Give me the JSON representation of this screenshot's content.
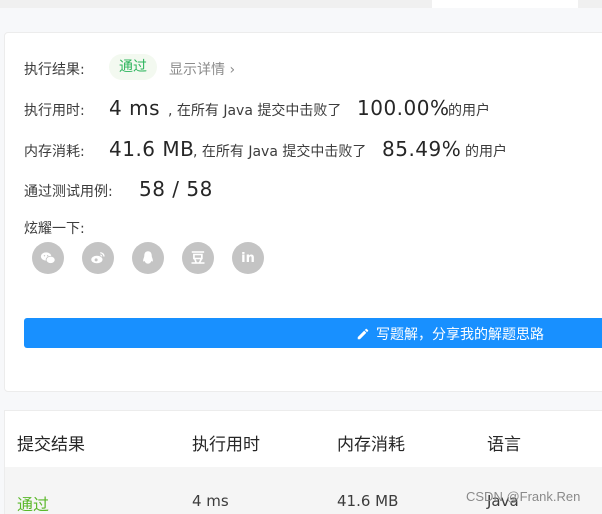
{
  "result": {
    "label": "执行结果:",
    "status": "通过",
    "details_link": "显示详情 ›"
  },
  "runtime": {
    "label": "执行用时:",
    "value": "4 ms",
    "mid_text": ", 在所有 Java 提交中击败了",
    "percent": "100.00%",
    "suffix": "的用户"
  },
  "memory": {
    "label": "内存消耗:",
    "value": "41.6 MB",
    "mid_text": ", 在所有 Java 提交中击败了",
    "percent": "85.49%",
    "suffix": "的用户"
  },
  "tests": {
    "label": "通过测试用例:",
    "value": "58 / 58"
  },
  "share": {
    "label": "炫耀一下:",
    "icons": [
      "wechat-icon",
      "weibo-icon",
      "qq-icon",
      "douban-icon",
      "linkedin-icon"
    ],
    "douban_glyph": "豆",
    "linkedin_glyph": "in"
  },
  "write_solution": {
    "label": "写题解，分享我的解题思路"
  },
  "submissions": {
    "headers": [
      "提交结果",
      "执行用时",
      "内存消耗",
      "语言"
    ],
    "rows": [
      {
        "status": "通过",
        "runtime": "4 ms",
        "memory": "41.6 MB",
        "language": "Java"
      }
    ]
  },
  "watermark": "CSDN @Frank.Ren",
  "colors": {
    "accent_blue": "#1890ff",
    "accepted_green": "#5bb82a",
    "pill_green": "#2db55d",
    "icon_gray": "#c4c4c4"
  }
}
